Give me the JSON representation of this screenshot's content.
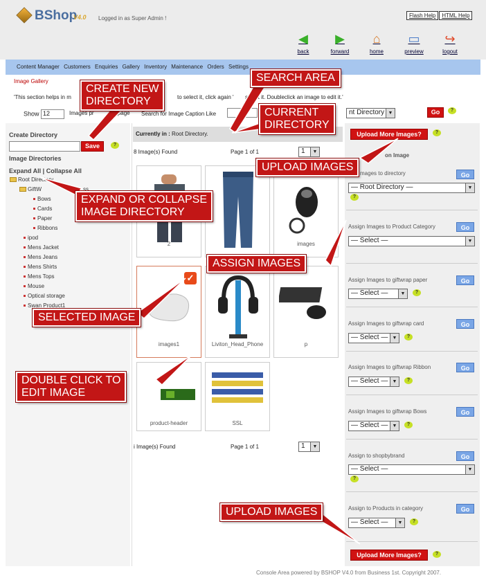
{
  "header": {
    "app_name": "BShop",
    "version": "V4.0",
    "logged_in": "Logged in as Super Admin !",
    "flash_help": "Flash Help",
    "html_help": "HTML Help"
  },
  "nav": {
    "back": "back",
    "forward": "forward",
    "home": "home",
    "preview": "preview",
    "logout": "logout"
  },
  "menu": [
    "Content Manager",
    "Customers",
    "Enquiries",
    "Gallery",
    "Inventory",
    "Maintenance",
    "Orders",
    "Settings"
  ],
  "breadcrumb": "Image Gallery",
  "info_text": "'This section helps in m",
  "info_text_2": "to select it, click again '",
  "info_text_3": "select it. Doubleclick an image to edit it.'",
  "toolbar": {
    "show_label": "Show",
    "show_value": "12",
    "images_per_page": "Images pr",
    "page_suffix": "page",
    "search_label": "Search for Image Caption Like",
    "dir_select": "nt Directory",
    "go": "Go"
  },
  "left": {
    "create_dir": "Create Directory",
    "save": "Save",
    "image_dirs": "Image Directories",
    "expand": "Expand All | Collapse All",
    "tree": {
      "root": "Root Directory",
      "gift": "GiftW",
      "gift_suffix": "ss",
      "children": [
        "Bows",
        "Cards",
        "Paper",
        "Ribbons"
      ],
      "items": [
        "ipod",
        "Mens Jacket",
        "Mens Jeans",
        "Mens Shirts",
        "Mens Tops",
        "Mouse",
        "Optical storage",
        "Swan Product1"
      ]
    }
  },
  "middle": {
    "current_label": "Currently in :",
    "current_dir": "Root Directory.",
    "found_top": "8 Image(s) Found",
    "found_bottom": "i Image(s) Found",
    "page_of": "Page 1 of 1",
    "page_select": "1",
    "thumbs": [
      "2",
      "",
      "images",
      "images1",
      "Liviton_Head_Phone",
      "p",
      "product-header",
      "SSL"
    ]
  },
  "right": {
    "upload": "Upload More Images?",
    "actions_on_image": "on Image",
    "move_images": "mages to directory",
    "root_dir": "— Root Directory —",
    "select": "— Select —",
    "select_short": "— Select —",
    "sections": [
      "Assign Images to Product Category",
      "Assign Images to giftwrap paper",
      "Assign Images to giftwrap card",
      "Assign Images to giftwrap Ribbon",
      "Assign Images to giftwrap Bows",
      "Assign to shopbybrand",
      "Assign to Products in category"
    ],
    "go": "Go"
  },
  "callouts": {
    "create": "CREATE NEW\nDIRECTORY",
    "search": "SEARCH AREA",
    "current": "CURRENT\nDIRECTORY",
    "upload_top": "UPLOAD IMAGES",
    "expand": "EXPAND OR COLLAPSE\nIMAGE DIRECTORY",
    "assign": "ASSIGN IMAGES",
    "selected": "SELECTED IMAGE",
    "double": "DOUBLE CLICK TO\nEDIT IMAGE",
    "upload_bottom": "UPLOAD IMAGES"
  },
  "footer": "Console Area powered by BSHOP V4.0 from Business 1st. Copyright 2007."
}
